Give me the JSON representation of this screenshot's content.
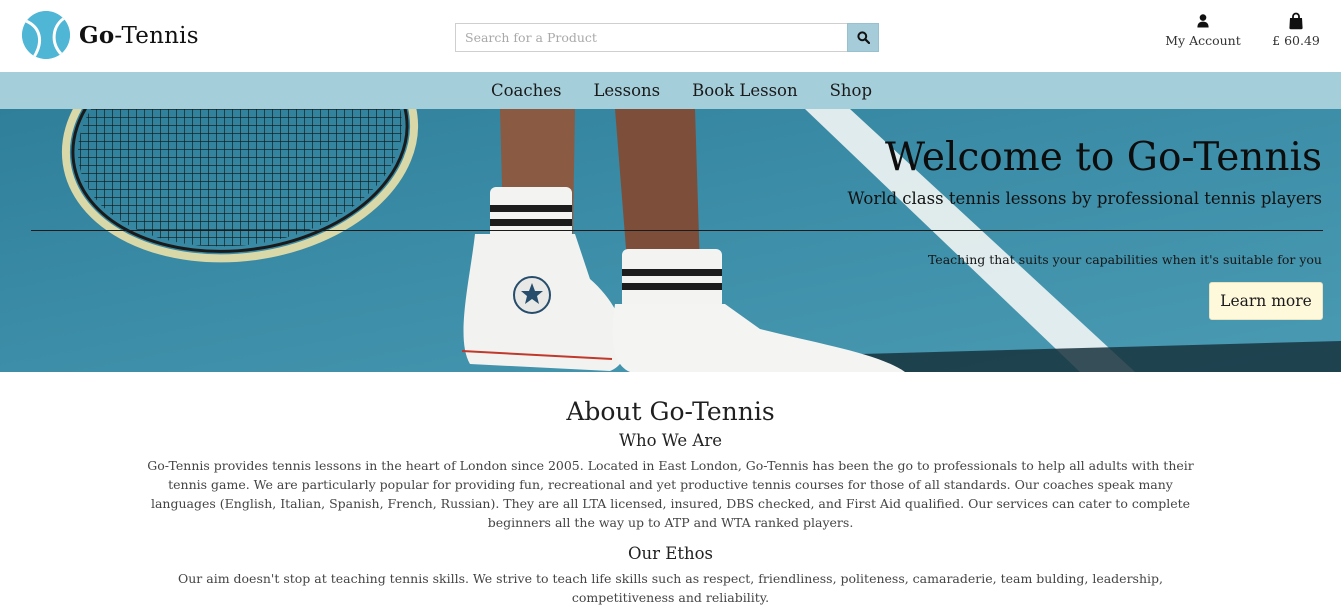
{
  "brand": {
    "name_bold": "Go",
    "name_rest": "-Tennis"
  },
  "search": {
    "placeholder": "Search for a Product",
    "icon": "search-icon"
  },
  "header": {
    "account_label": "My Account",
    "account_icon": "user-icon",
    "cart_label": "£ 60.49",
    "cart_icon": "shopping-bag-icon"
  },
  "nav": {
    "items": [
      "Coaches",
      "Lessons",
      "Book Lesson",
      "Shop"
    ]
  },
  "hero": {
    "title": "Welcome to Go-Tennis",
    "subtitle": "World class tennis lessons by professional tennis players",
    "tagline": "Teaching that suits your capabilities when it's suitable for you",
    "button_label": "Learn more"
  },
  "about": {
    "title": "About Go-Tennis",
    "who_heading": "Who We Are",
    "who_text": "Go-Tennis provides tennis lessons in the heart of London since 2005. Located in East London, Go-Tennis has been the go to professionals to help all adults with their tennis game. We are particularly popular for providing fun, recreational and yet productive tennis courses for those of all standards. Our coaches speak many languages (English, Italian, Spanish, French, Russian). They are all LTA licensed, insured, DBS checked, and First Aid qualified. Our services can cater to complete beginners all the way up to ATP and WTA ranked players.",
    "ethos_heading": "Our Ethos",
    "ethos_text": "Our aim doesn't stop at teaching tennis skills. We strive to teach life skills such as respect, friendliness, politeness, camaraderie, team bulding, leadership, competitiveness and reliability."
  },
  "colors": {
    "nav_bg": "#a5cedb",
    "court_blue": "#3e8ba4",
    "button_bg": "#fff9dc",
    "logo_ball": "#4fb6d6"
  }
}
